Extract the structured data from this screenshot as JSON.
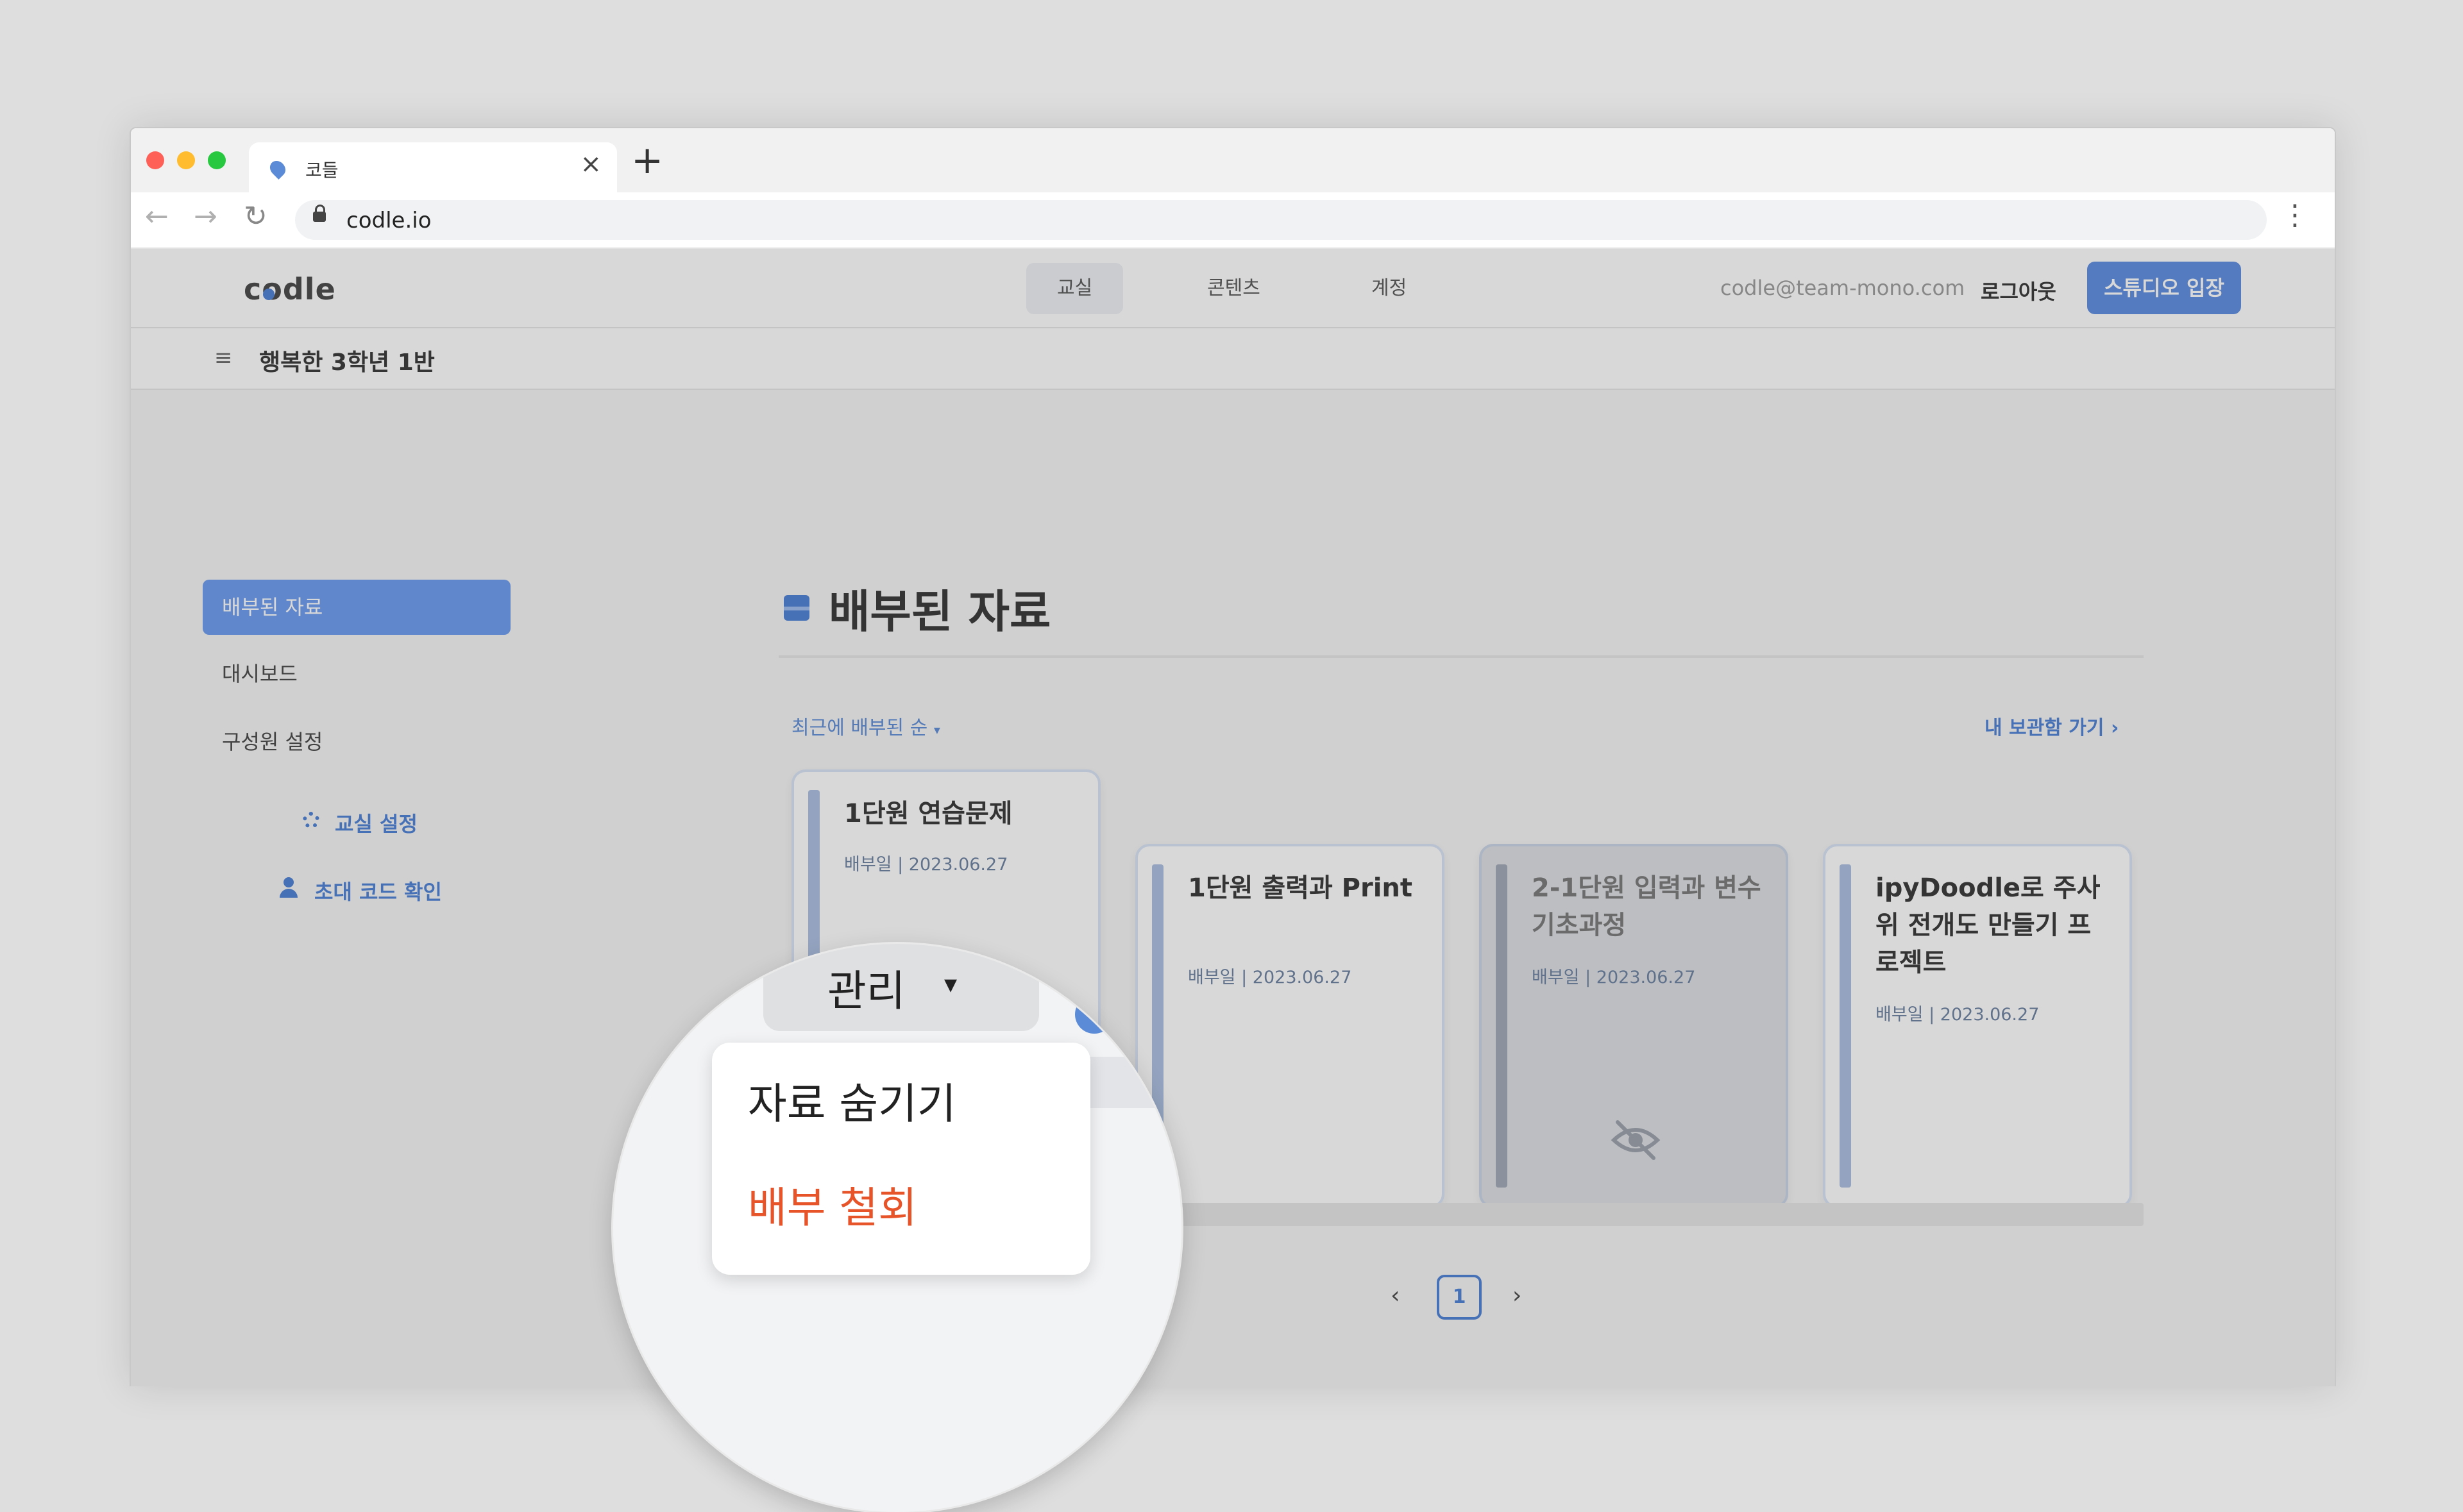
{
  "browser": {
    "tab_title": "코들",
    "tab_close": "×",
    "new_tab": "+",
    "url": "codle.io",
    "back": "←",
    "forward": "→",
    "reload": "↻",
    "menu": "⋮"
  },
  "header": {
    "logo": "codle",
    "nav": [
      "교실",
      "콘텐츠",
      "계정"
    ],
    "active_nav": "교실",
    "email": "codle@team-mono.com",
    "logout": "로그아웃",
    "studio_button": "스튜디오 입장"
  },
  "class_bar": {
    "menu_icon": "≡",
    "class_name": "행복한 3학년 1반"
  },
  "sidebar": {
    "items": [
      {
        "label": "배부된 자료",
        "active": true
      },
      {
        "label": "대시보드",
        "active": false
      },
      {
        "label": "구성원 설정",
        "active": false
      }
    ],
    "links": [
      {
        "icon": "gear-icon",
        "label": "교실 설정"
      },
      {
        "icon": "user-plus-icon",
        "label": "초대 코드 확인"
      }
    ]
  },
  "main": {
    "title": "배부된 자료",
    "sort_label": "최근에 배부된 순",
    "sort_caret": "▾",
    "storage_link": "내 보관함 가기",
    "storage_chevron": "›",
    "cards": [
      {
        "title": "1단원 연습문제",
        "date": "배부일 | 2023.06.27",
        "hidden": false
      },
      {
        "title": "1단원 출력과 Print",
        "date": "배부일 | 2023.06.27",
        "hidden": false
      },
      {
        "title": "2-1단원 입력과 변수 기초과정",
        "date": "배부일 | 2023.06.27",
        "hidden": true
      },
      {
        "title": "ipyDoodle로 주사위 전개도 만들기 프로젝트",
        "date": "배부일 | 2023.06.27",
        "hidden": false
      }
    ],
    "pagination": {
      "prev": "‹",
      "current": "1",
      "next": "›"
    }
  },
  "dropdown": {
    "manage_label": "관리",
    "caret": "▾",
    "items": [
      {
        "label": "자료 숨기기",
        "color": "#222222"
      },
      {
        "label": "배부 철회",
        "color": "#e8542a"
      }
    ]
  },
  "colors": {
    "accent": "#5a8be0",
    "danger": "#e8542a"
  }
}
